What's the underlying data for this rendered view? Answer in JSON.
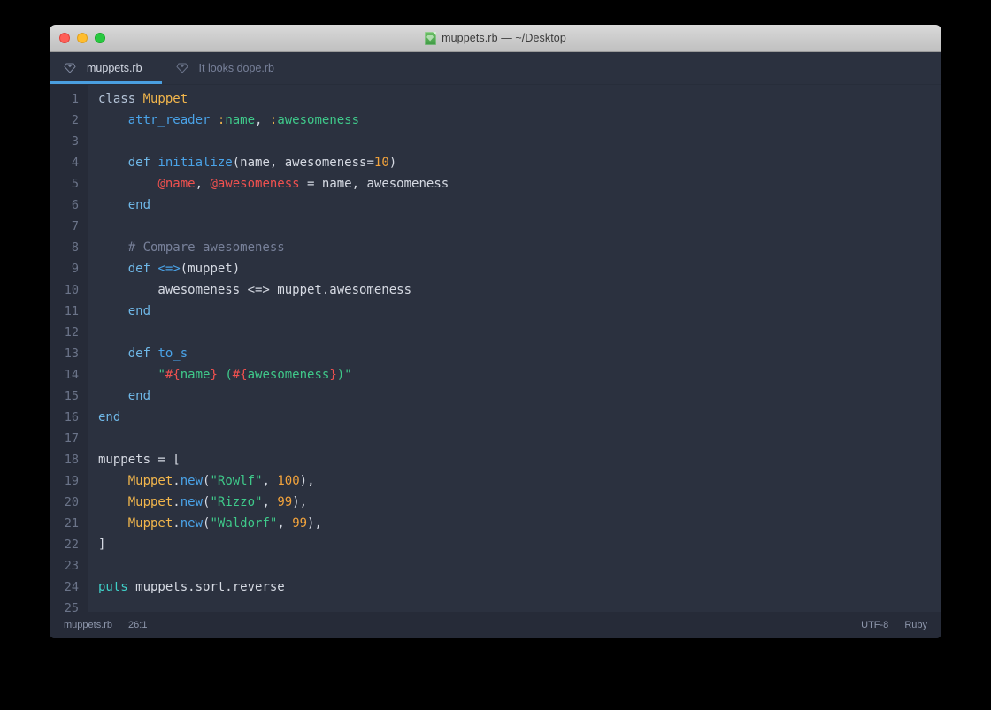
{
  "window": {
    "title": "muppets.rb — ~/Desktop",
    "title_icon": "ruby-document-icon",
    "traffic_lights": [
      {
        "name": "close-button",
        "color": "#ff5f57"
      },
      {
        "name": "minimize-button",
        "color": "#ffbd2e"
      },
      {
        "name": "maximize-button",
        "color": "#28c840"
      }
    ]
  },
  "tabs": [
    {
      "label": "muppets.rb",
      "icon": "ruby-gem-icon",
      "active": true
    },
    {
      "label": "It looks dope.rb",
      "icon": "ruby-gem-icon",
      "active": false
    }
  ],
  "editor": {
    "language": "Ruby",
    "line_numbers": [
      "1",
      "2",
      "3",
      "4",
      "5",
      "6",
      "7",
      "8",
      "9",
      "10",
      "11",
      "12",
      "13",
      "14",
      "15",
      "16",
      "17",
      "18",
      "19",
      "20",
      "21",
      "22",
      "23",
      "24",
      "25"
    ],
    "lines": [
      [
        {
          "t": "class ",
          "c": "t-kw"
        },
        {
          "t": "Muppet",
          "c": "t-const"
        }
      ],
      [
        {
          "t": "    ",
          "c": "t-plain"
        },
        {
          "t": "attr_reader",
          "c": "t-fn"
        },
        {
          "t": " ",
          "c": "t-plain"
        },
        {
          "t": ":",
          "c": "t-symcolon"
        },
        {
          "t": "name",
          "c": "t-sym"
        },
        {
          "t": ", ",
          "c": "t-plain"
        },
        {
          "t": ":",
          "c": "t-symcolon"
        },
        {
          "t": "awesomeness",
          "c": "t-sym"
        }
      ],
      [],
      [
        {
          "t": "    ",
          "c": "t-plain"
        },
        {
          "t": "def ",
          "c": "t-def"
        },
        {
          "t": "initialize",
          "c": "t-fn"
        },
        {
          "t": "(name, awesomeness=",
          "c": "t-plain"
        },
        {
          "t": "10",
          "c": "t-num"
        },
        {
          "t": ")",
          "c": "t-plain"
        }
      ],
      [
        {
          "t": "        ",
          "c": "t-plain"
        },
        {
          "t": "@name",
          "c": "t-ivar"
        },
        {
          "t": ", ",
          "c": "t-plain"
        },
        {
          "t": "@awesomeness",
          "c": "t-ivar"
        },
        {
          "t": " = name, awesomeness",
          "c": "t-plain"
        }
      ],
      [
        {
          "t": "    ",
          "c": "t-plain"
        },
        {
          "t": "end",
          "c": "t-def"
        }
      ],
      [],
      [
        {
          "t": "    ",
          "c": "t-plain"
        },
        {
          "t": "# Compare awesomeness",
          "c": "t-comment"
        }
      ],
      [
        {
          "t": "    ",
          "c": "t-plain"
        },
        {
          "t": "def ",
          "c": "t-def"
        },
        {
          "t": "<=>",
          "c": "t-op"
        },
        {
          "t": "(muppet)",
          "c": "t-plain"
        }
      ],
      [
        {
          "t": "        awesomeness <=> muppet.awesomeness",
          "c": "t-plain"
        }
      ],
      [
        {
          "t": "    ",
          "c": "t-plain"
        },
        {
          "t": "end",
          "c": "t-def"
        }
      ],
      [],
      [
        {
          "t": "    ",
          "c": "t-plain"
        },
        {
          "t": "def ",
          "c": "t-def"
        },
        {
          "t": "to_s",
          "c": "t-fn"
        }
      ],
      [
        {
          "t": "        ",
          "c": "t-plain"
        },
        {
          "t": "\"",
          "c": "t-str"
        },
        {
          "t": "#{",
          "c": "t-interp"
        },
        {
          "t": "name",
          "c": "t-str"
        },
        {
          "t": "}",
          "c": "t-interp"
        },
        {
          "t": " (",
          "c": "t-str"
        },
        {
          "t": "#{",
          "c": "t-interp"
        },
        {
          "t": "awesomeness",
          "c": "t-str"
        },
        {
          "t": "}",
          "c": "t-interp"
        },
        {
          "t": ")\"",
          "c": "t-str"
        }
      ],
      [
        {
          "t": "    ",
          "c": "t-plain"
        },
        {
          "t": "end",
          "c": "t-def"
        }
      ],
      [
        {
          "t": "end",
          "c": "t-def"
        }
      ],
      [],
      [
        {
          "t": "muppets = [",
          "c": "t-plain"
        }
      ],
      [
        {
          "t": "    ",
          "c": "t-plain"
        },
        {
          "t": "Muppet",
          "c": "t-const"
        },
        {
          "t": ".",
          "c": "t-plain"
        },
        {
          "t": "new",
          "c": "t-method"
        },
        {
          "t": "(",
          "c": "t-plain"
        },
        {
          "t": "\"Rowlf\"",
          "c": "t-str"
        },
        {
          "t": ", ",
          "c": "t-plain"
        },
        {
          "t": "100",
          "c": "t-num"
        },
        {
          "t": "),",
          "c": "t-plain"
        }
      ],
      [
        {
          "t": "    ",
          "c": "t-plain"
        },
        {
          "t": "Muppet",
          "c": "t-const"
        },
        {
          "t": ".",
          "c": "t-plain"
        },
        {
          "t": "new",
          "c": "t-method"
        },
        {
          "t": "(",
          "c": "t-plain"
        },
        {
          "t": "\"Rizzo\"",
          "c": "t-str"
        },
        {
          "t": ", ",
          "c": "t-plain"
        },
        {
          "t": "99",
          "c": "t-num"
        },
        {
          "t": "),",
          "c": "t-plain"
        }
      ],
      [
        {
          "t": "    ",
          "c": "t-plain"
        },
        {
          "t": "Muppet",
          "c": "t-const"
        },
        {
          "t": ".",
          "c": "t-plain"
        },
        {
          "t": "new",
          "c": "t-method"
        },
        {
          "t": "(",
          "c": "t-plain"
        },
        {
          "t": "\"Waldorf\"",
          "c": "t-str"
        },
        {
          "t": ", ",
          "c": "t-plain"
        },
        {
          "t": "99",
          "c": "t-num"
        },
        {
          "t": "),",
          "c": "t-plain"
        }
      ],
      [
        {
          "t": "]",
          "c": "t-plain"
        }
      ],
      [],
      [
        {
          "t": "puts",
          "c": "t-puts"
        },
        {
          "t": " muppets.sort.reverse",
          "c": "t-plain"
        }
      ],
      []
    ]
  },
  "statusbar": {
    "filename": "muppets.rb",
    "cursor": "26:1",
    "encoding": "UTF-8",
    "syntax": "Ruby"
  },
  "colors": {
    "window_bg": "#2b313f",
    "gutter_bg": "#262b38",
    "accent": "#4a9fe0",
    "text": "#d6dae3"
  }
}
